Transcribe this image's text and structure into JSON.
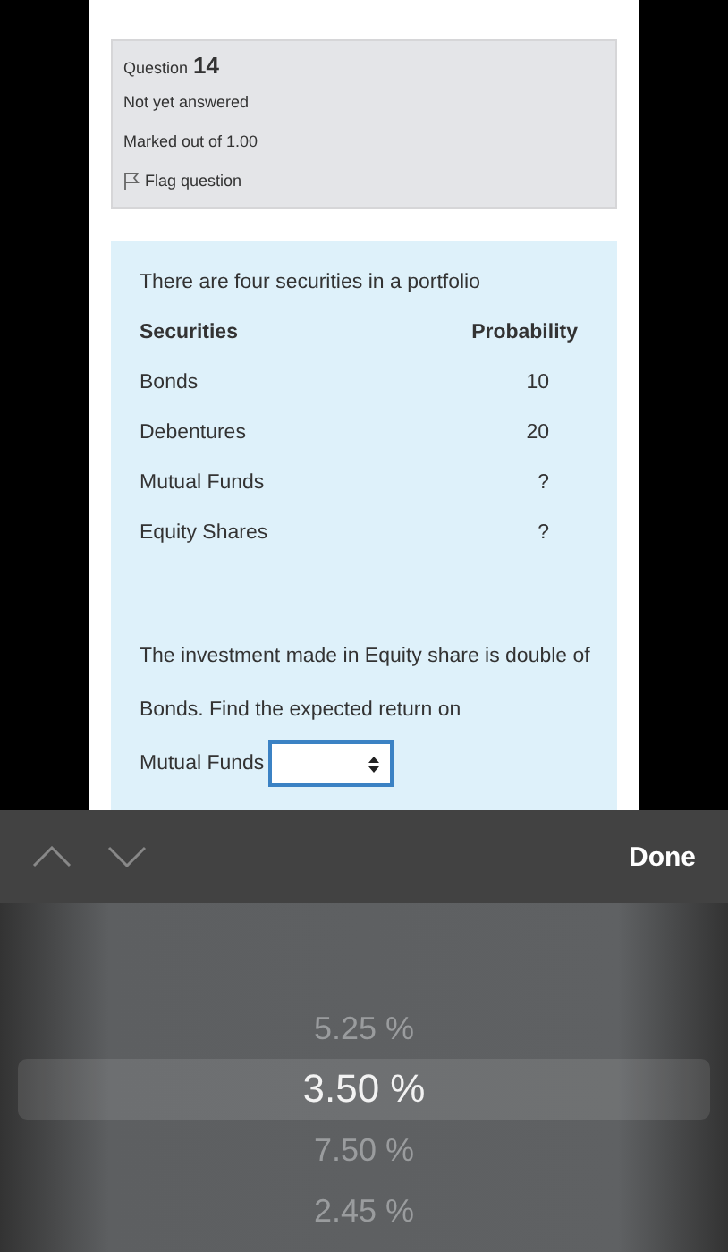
{
  "question_info": {
    "label": "Question",
    "number": "14",
    "state": "Not yet answered",
    "marks": "Marked out of 1.00",
    "flag": "Flag question"
  },
  "question": {
    "intro": "There are four securities in a portfolio",
    "table": {
      "columns": [
        "Securities",
        "Probability"
      ],
      "rows": [
        [
          "Bonds",
          "10"
        ],
        [
          "Debentures",
          "20"
        ],
        [
          "Mutual Funds",
          "?"
        ],
        [
          "Equity Shares",
          "?"
        ]
      ]
    },
    "text": "The investment made in Equity share is double of Bonds. Find the expected return on",
    "answer_label": "Mutual Funds"
  },
  "picker_toolbar": {
    "done": "Done"
  },
  "picker": {
    "options": [
      {
        "label": "5.25 %",
        "selected": false
      },
      {
        "label": "3.50 %",
        "selected": true
      },
      {
        "label": "7.50 %",
        "selected": false
      },
      {
        "label": "2.45 %",
        "selected": false
      }
    ]
  }
}
